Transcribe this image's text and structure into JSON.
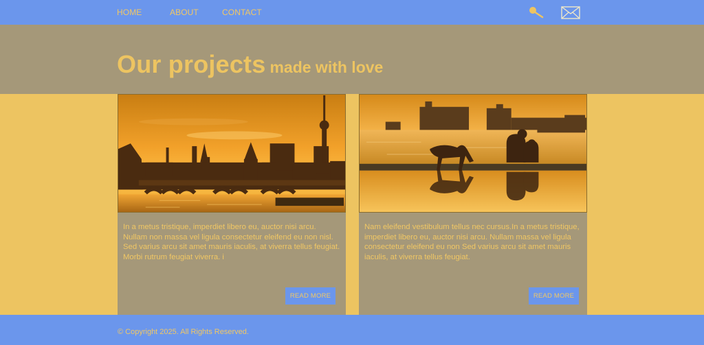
{
  "nav": {
    "items": [
      {
        "label": "HOME"
      },
      {
        "label": "ABOUT"
      },
      {
        "label": "CONTACT"
      }
    ],
    "icons": [
      "search-icon",
      "mail-icon"
    ]
  },
  "hero": {
    "title": "Our projects",
    "subtitle": "made with love"
  },
  "cards": [
    {
      "image": "berlin-skyline-sunset-photo",
      "text": "In a metus tristique, imperdiet libero eu, auctor nisi arcu. Nullam non massa vel ligula consectetur eleifend eu non nisl.  Sed varius arcu sit amet mauris iaculis, at viverra tellus feugiat. Morbi rutrum feugiat viverra. i",
      "button": "READ MORE"
    },
    {
      "image": "waterfront-dog-couple-photo",
      "text": "Nam eleifend vestibulum tellus nec cursus.In a metus tristique, imperdiet libero eu, auctor nisi arcu. Nullam massa vel ligula consectetur eleifend eu non Sed varius arcu sit amet mauris iaculis, at viverra tellus feugiat.",
      "button": "READ MORE"
    }
  ],
  "footer": {
    "copyright": "© Copyright 2025.  All Rights Reserved."
  },
  "colors": {
    "nav_blue": "#6b96ec",
    "accent_yellow": "#edc461",
    "panel_taupe": "#a59879"
  }
}
